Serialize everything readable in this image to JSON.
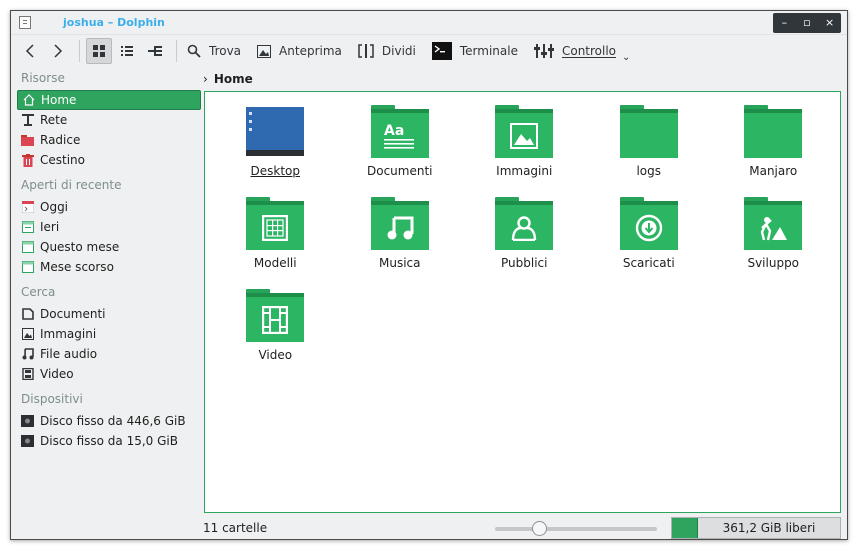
{
  "window": {
    "title": "joshua – Dolphin"
  },
  "titlebar_buttons": {
    "minimize": "–",
    "maximize": "▫",
    "close": "×"
  },
  "toolbar": {
    "find": "Trova",
    "preview": "Anteprima",
    "split": "Dividi",
    "terminal": "Terminale",
    "control": "Controllo"
  },
  "sidebar": {
    "places_header": "Risorse",
    "places": [
      {
        "label": "Home",
        "icon": "home-icon"
      },
      {
        "label": "Rete",
        "icon": "network-icon"
      },
      {
        "label": "Radice",
        "icon": "root-folder-icon"
      },
      {
        "label": "Cestino",
        "icon": "trash-icon"
      }
    ],
    "recent_header": "Aperti di recente",
    "recent": [
      {
        "label": "Oggi",
        "icon": "calendar-today-icon"
      },
      {
        "label": "Ieri",
        "icon": "calendar-yesterday-icon"
      },
      {
        "label": "Questo mese",
        "icon": "calendar-month-icon"
      },
      {
        "label": "Mese scorso",
        "icon": "calendar-lastmonth-icon"
      }
    ],
    "search_header": "Cerca",
    "search": [
      {
        "label": "Documenti",
        "icon": "document-icon"
      },
      {
        "label": "Immagini",
        "icon": "image-icon"
      },
      {
        "label": "File audio",
        "icon": "music-icon"
      },
      {
        "label": "Video",
        "icon": "video-icon"
      }
    ],
    "devices_header": "Dispositivi",
    "devices": [
      {
        "label": "Disco fisso da 446,6 GiB",
        "icon": "harddisk-icon"
      },
      {
        "label": "Disco fisso da 15,0 GiB",
        "icon": "harddisk-icon"
      }
    ]
  },
  "breadcrumb": {
    "current": "Home"
  },
  "files": [
    {
      "name": "Desktop",
      "icon": "desktop-icon"
    },
    {
      "name": "Documenti",
      "icon": "folder-documents-icon"
    },
    {
      "name": "Immagini",
      "icon": "folder-pictures-icon"
    },
    {
      "name": "logs",
      "icon": "folder-icon"
    },
    {
      "name": "Manjaro",
      "icon": "folder-icon"
    },
    {
      "name": "Modelli",
      "icon": "folder-templates-icon"
    },
    {
      "name": "Musica",
      "icon": "folder-music-icon"
    },
    {
      "name": "Pubblici",
      "icon": "folder-public-icon"
    },
    {
      "name": "Scaricati",
      "icon": "folder-download-icon"
    },
    {
      "name": "Sviluppo",
      "icon": "folder-development-icon"
    },
    {
      "name": "Video",
      "icon": "folder-videos-icon"
    }
  ],
  "status": {
    "count": "11 cartelle",
    "zoom_fraction": 0.25,
    "free_space": "361,2 GiB liberi",
    "used_fraction": 0.15
  },
  "colors": {
    "accent": "#2ea45f",
    "title": "#3daee9"
  }
}
